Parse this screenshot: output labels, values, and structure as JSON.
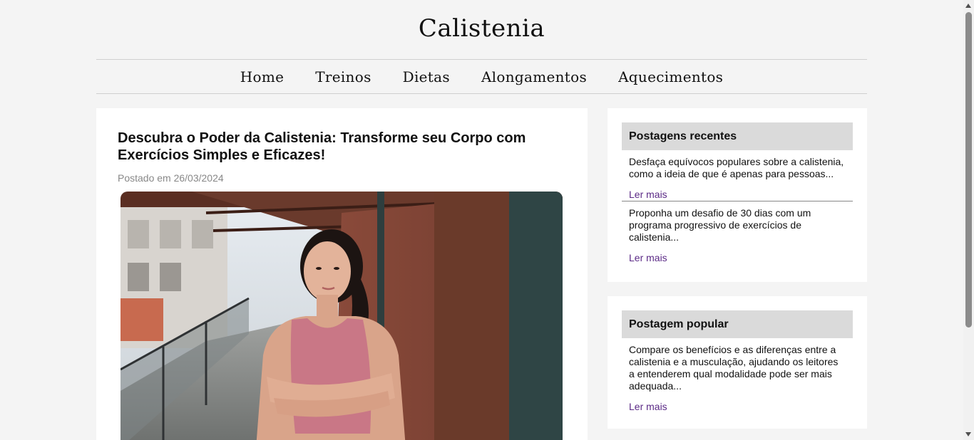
{
  "site": {
    "title": "Calistenia"
  },
  "nav": {
    "items": [
      {
        "label": "Home"
      },
      {
        "label": "Treinos"
      },
      {
        "label": "Dietas"
      },
      {
        "label": "Alongamentos"
      },
      {
        "label": "Aquecimentos"
      }
    ]
  },
  "post": {
    "title": "Descubra o Poder da Calistenia: Transforme seu Corpo com Exercícios Simples e Eficazes!",
    "date": "Postado em 26/03/2024"
  },
  "recent": {
    "heading": "Postagens recentes",
    "items": [
      {
        "excerpt": "Desfaça equívocos populares sobre a calistenia, como a ideia de que é apenas para pessoas...",
        "link": "Ler mais"
      },
      {
        "excerpt": "Proponha um desafio de 30 dias com um programa progressivo de exercícios de calistenia...",
        "link": "Ler mais"
      }
    ]
  },
  "popular": {
    "heading": "Postagem popular",
    "items": [
      {
        "excerpt": "Compare os benefícios e as diferenças entre a calistenia e a musculação, ajudando os leitores a entenderem qual modalidade pode ser mais adequada...",
        "link": "Ler mais"
      }
    ]
  },
  "colors": {
    "background": "#f4f4f4",
    "card": "#ffffff",
    "sidebar_header": "#dadada",
    "link": "#5b2a86",
    "date": "#888888"
  }
}
